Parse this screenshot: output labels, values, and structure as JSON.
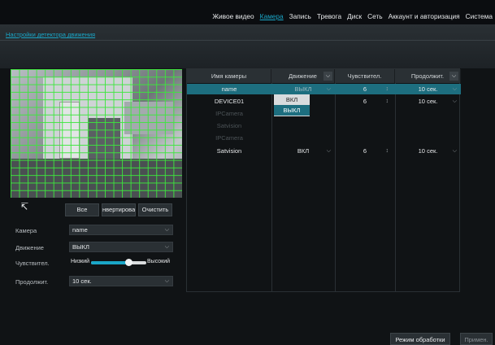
{
  "nav": {
    "items": [
      "Живое видео",
      "Камера",
      "Запись",
      "Тревога",
      "Диск",
      "Сеть",
      "Аккаунт и авторизация",
      "Система"
    ],
    "active_index": 1
  },
  "page": {
    "title": "Настройки детектора движения"
  },
  "grid_buttons": {
    "all": "Все",
    "invert": "нвертирова",
    "clear": "Очистить"
  },
  "form": {
    "camera": {
      "label": "Камера",
      "value": "name"
    },
    "motion": {
      "label": "Движение",
      "value": "ВЫКЛ"
    },
    "sensitivity": {
      "label": "Чувствител.",
      "low": "Низкий",
      "high": "Высокий",
      "value_fraction": 0.68
    },
    "duration": {
      "label": "Продолжит.",
      "value": "10 сек."
    }
  },
  "table": {
    "headers": [
      "Имя камеры",
      "Движение",
      "Чувствител.",
      "Продолжит."
    ],
    "rows": [
      {
        "name": "name",
        "motion": "ВЫКЛ",
        "sens": "6",
        "dur": "10 сек.",
        "selected": true,
        "dim": false
      },
      {
        "name": "DEVICE01",
        "motion": "",
        "sens": "6",
        "dur": "10 сек.",
        "selected": false,
        "dim": false
      },
      {
        "name": "IPCamera",
        "motion": "",
        "sens": "",
        "dur": "",
        "selected": false,
        "dim": true
      },
      {
        "name": "Satvision",
        "motion": "",
        "sens": "",
        "dur": "",
        "selected": false,
        "dim": true
      },
      {
        "name": "IPCamera",
        "motion": "",
        "sens": "",
        "dur": "",
        "selected": false,
        "dim": true
      },
      {
        "name": "Satvision",
        "motion": "ВКЛ",
        "sens": "6",
        "dur": "10 сек.",
        "selected": false,
        "dim": false
      }
    ]
  },
  "motion_dropdown": {
    "options": [
      "ВКЛ",
      "ВЫКЛ"
    ],
    "highlighted_index": 1
  },
  "footer": {
    "process_mode": "Режим обработки",
    "apply": "Примен."
  },
  "colors": {
    "accent": "#1aa6c7",
    "selected_row": "#1d6e7f",
    "grid": "#3ce63c"
  }
}
